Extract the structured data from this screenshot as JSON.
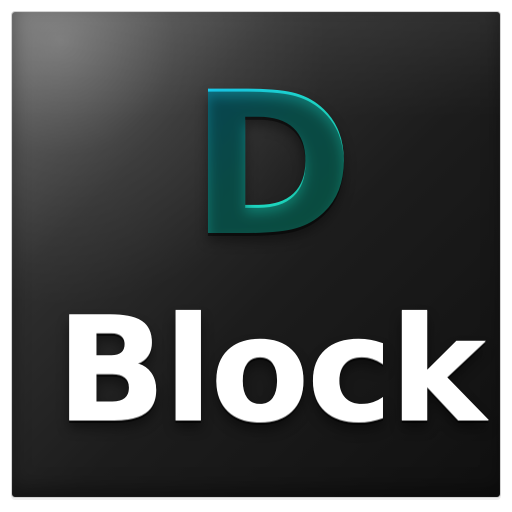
{
  "icon": {
    "primary_letter": "D",
    "word": "Block"
  },
  "colors": {
    "letter_gradient_start": "#17c8ff",
    "letter_gradient_end": "#1fe9b4",
    "word_text": "#ffffff",
    "tile_dark": "#101010",
    "tile_highlight": "#5a5a5a"
  }
}
